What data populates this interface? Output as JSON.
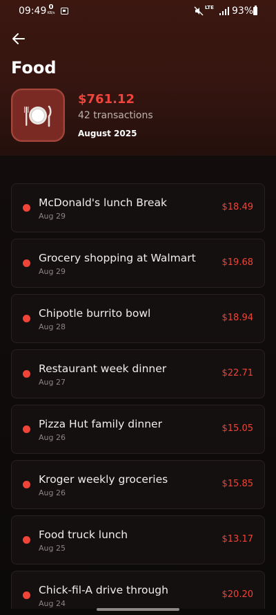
{
  "status_bar": {
    "time": "09:49",
    "net_speed": "0",
    "net_unit": "KB/s",
    "network": "LTE",
    "battery": "93%"
  },
  "header": {
    "title": "Food",
    "icon": "plate-fork-knife-icon",
    "amount": "$761.12",
    "transactions": "42 transactions",
    "period": "August 2025"
  },
  "transactions": [
    {
      "name": "McDonald's lunch Break",
      "date": "Aug 29",
      "amount": "$18.49"
    },
    {
      "name": "Grocery shopping at Walmart",
      "date": "Aug 29",
      "amount": "$19.68"
    },
    {
      "name": "Chipotle burrito bowl",
      "date": "Aug 28",
      "amount": "$18.94"
    },
    {
      "name": "Restaurant week dinner",
      "date": "Aug 27",
      "amount": "$22.71"
    },
    {
      "name": "Pizza Hut family dinner",
      "date": "Aug 26",
      "amount": "$15.05"
    },
    {
      "name": "Kroger weekly groceries",
      "date": "Aug 26",
      "amount": "$15.85"
    },
    {
      "name": "Food truck lunch",
      "date": "Aug 25",
      "amount": "$13.17"
    },
    {
      "name": "Chick-fil-A drive through",
      "date": "Aug 24",
      "amount": "$20.20"
    }
  ],
  "colors": {
    "accent": "#ef4437",
    "header_bg": "#3b1710",
    "card_bg": "#141010"
  }
}
